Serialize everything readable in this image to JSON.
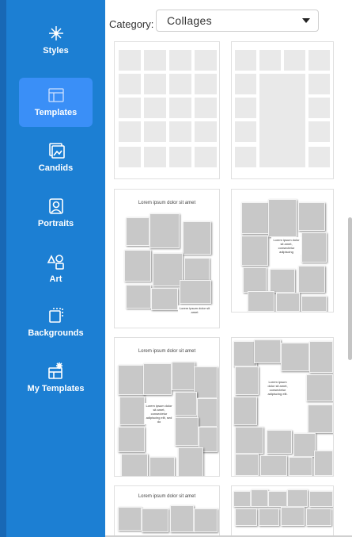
{
  "sidebar": {
    "items": [
      {
        "label": "Styles",
        "icon": "styles-icon",
        "active": false
      },
      {
        "label": "Templates",
        "icon": "templates-icon",
        "active": true
      },
      {
        "label": "Candids",
        "icon": "candids-icon",
        "active": false
      },
      {
        "label": "Portraits",
        "icon": "portraits-icon",
        "active": false
      },
      {
        "label": "Art",
        "icon": "art-icon",
        "active": false
      },
      {
        "label": "Backgrounds",
        "icon": "backgrounds-icon",
        "active": false
      },
      {
        "label": "My Templates",
        "icon": "my-templates-icon",
        "active": false
      }
    ],
    "colors": {
      "background": "#1c7fd3",
      "active": "#3a8ff7"
    }
  },
  "header": {
    "category_label": "Category:",
    "category_value": "Collages"
  },
  "templates": {
    "row2": {
      "left_title": "Lorem ipsum dolor sit amet",
      "left_text": "Lorem ipsum dolor sit amet",
      "right_text": "Lorem ipsum dolor sit amet, consectetur adipiscing"
    },
    "row3": {
      "left_title": "Lorem ipsum dolor sit amet",
      "left_text": "Lorem ipsum dolor sit amet, consectetur adipiscing elit, sed do",
      "right_text": "Lorem ipsum dolor sit amet, consectetur adipiscing elit."
    },
    "row4": {
      "left_title": "Lorem ipsum dolor sit amet"
    }
  }
}
